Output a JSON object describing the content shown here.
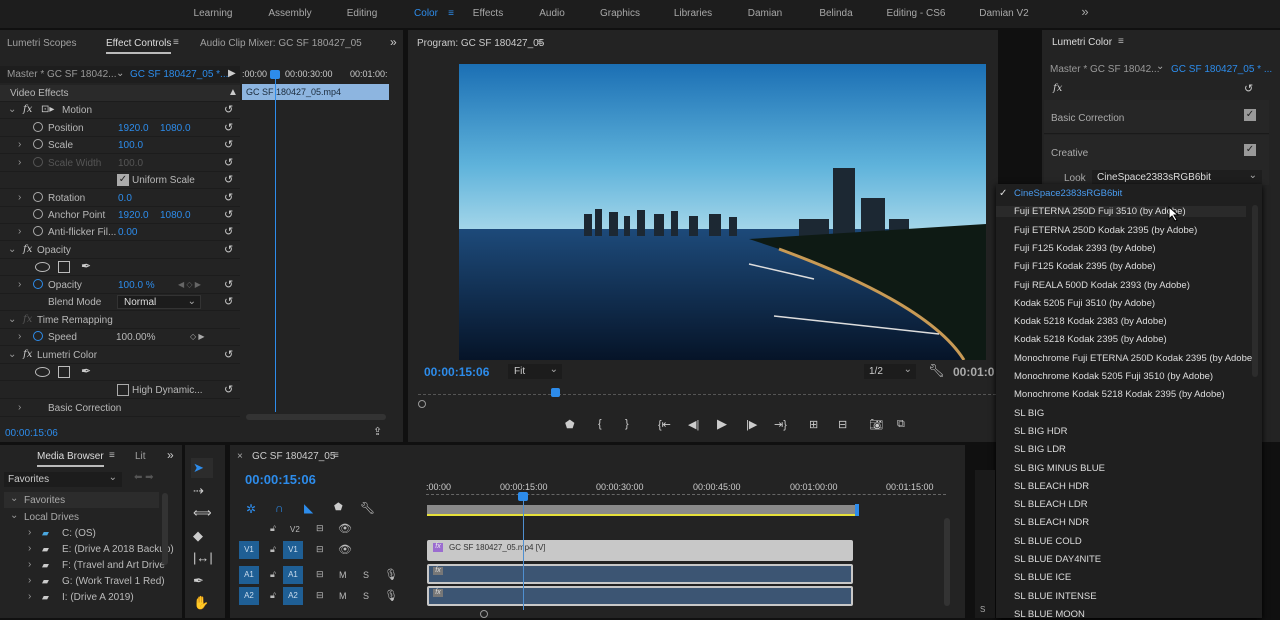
{
  "workspaces": {
    "items": [
      "Learning",
      "Assembly",
      "Editing",
      "Color",
      "Effects",
      "Audio",
      "Graphics",
      "Libraries",
      "Damian",
      "Belinda",
      "Editing - CS6",
      "Damian V2"
    ],
    "active": "Color",
    "more": "»"
  },
  "left_panel": {
    "tabs": [
      "Lumetri Scopes",
      "Effect Controls",
      "Audio Clip Mixer: GC SF 180427_05"
    ],
    "master": "Master * GC SF 18042...",
    "sequence_clip": "GC SF 180427_05 *...",
    "section": "Video Effects",
    "timecodes": [
      ":00:00",
      "00:00:30:00",
      "00:01:00:"
    ],
    "clip_name": "GC SF 180427_05.mp4",
    "motion": "Motion",
    "position": {
      "label": "Position",
      "x": "1920.0",
      "y": "1080.0"
    },
    "scale": {
      "label": "Scale",
      "value": "100.0"
    },
    "scale_width": {
      "label": "Scale Width",
      "value": "100.0"
    },
    "uniform_scale": {
      "label": "Uniform Scale",
      "checked": true
    },
    "rotation": {
      "label": "Rotation",
      "value": "0.0"
    },
    "anchor_point": {
      "label": "Anchor Point",
      "x": "1920.0",
      "y": "1080.0"
    },
    "anti_flicker": {
      "label": "Anti-flicker Fil...",
      "value": "0.00"
    },
    "opacity_group": "Opacity",
    "opacity": {
      "label": "Opacity",
      "value": "100.0 %"
    },
    "blend_mode": {
      "label": "Blend Mode",
      "value": "Normal"
    },
    "time_remapping": "Time Remapping",
    "speed": {
      "label": "Speed",
      "value": "100.00%"
    },
    "lumetri": "Lumetri Color",
    "high_dynamic": "High Dynamic...",
    "basic_correction": "Basic Correction",
    "current_time": "00:00:15:06"
  },
  "program": {
    "title": "Program: GC SF 180427_05",
    "timecode": "00:00:15:06",
    "fit": "Fit",
    "resolution": "1/2",
    "duration": "00:01:0"
  },
  "lumetri": {
    "title": "Lumetri Color",
    "master": "Master * GC SF 18042...",
    "clip": "GC SF 180427_05 * ...",
    "basic_correction": "Basic Correction",
    "creative": "Creative",
    "look_label": "Look",
    "look_value": "CineSpace2383sRGB6bit",
    "options": [
      "CineSpace2383sRGB6bit",
      "Fuji ETERNA 250D Fuji 3510 (by Adobe)",
      "Fuji ETERNA 250D Kodak 2395 (by Adobe)",
      "Fuji F125 Kodak 2393 (by Adobe)",
      "Fuji F125 Kodak 2395 (by Adobe)",
      "Fuji REALA 500D Kodak 2393 (by Adobe)",
      "Kodak 5205 Fuji 3510 (by Adobe)",
      "Kodak 5218 Kodak 2383 (by Adobe)",
      "Kodak 5218 Kodak 2395 (by Adobe)",
      "Monochrome Fuji ETERNA 250D Kodak 2395 (by Adobe)",
      "Monochrome Kodak 5205 Fuji 3510 (by Adobe)",
      "Monochrome Kodak 5218 Kodak 2395 (by Adobe)",
      "SL BIG",
      "SL BIG HDR",
      "SL BIG LDR",
      "SL BIG MINUS BLUE",
      "SL BLEACH HDR",
      "SL BLEACH LDR",
      "SL BLEACH NDR",
      "SL BLUE COLD",
      "SL BLUE DAY4NITE",
      "SL BLUE ICE",
      "SL BLUE INTENSE",
      "SL BLUE MOON"
    ]
  },
  "media_browser": {
    "tabs": [
      "Media Browser",
      "Lit"
    ],
    "location": "Favorites",
    "tree": [
      "Favorites",
      "Local Drives"
    ],
    "drives": [
      "C: (OS)",
      "E: (Drive A 2018 Backup)",
      "F: (Travel and Art Drive",
      "G: (Work Travel 1 Red)",
      "I: (Drive A 2019)"
    ]
  },
  "timeline": {
    "title": "GC SF 180427_05",
    "timecode": "00:00:15:06",
    "ruler": [
      ":00:00",
      "00:00:15:00",
      "00:00:30:00",
      "00:00:45:00",
      "00:01:00:00",
      "00:01:15:00"
    ],
    "tracks": {
      "v2": "V2",
      "v1": "V1",
      "a1": "A1",
      "a2": "A2",
      "m": "M",
      "s": "S"
    },
    "video_clip": "GC SF 180427_05.mp4 [V]",
    "audio_meter": "S"
  },
  "colors": {
    "accent": "#2d8ceb",
    "panel": "#232323",
    "clip_video": "#c8c8c8",
    "clip_audio": "#3c5573"
  }
}
